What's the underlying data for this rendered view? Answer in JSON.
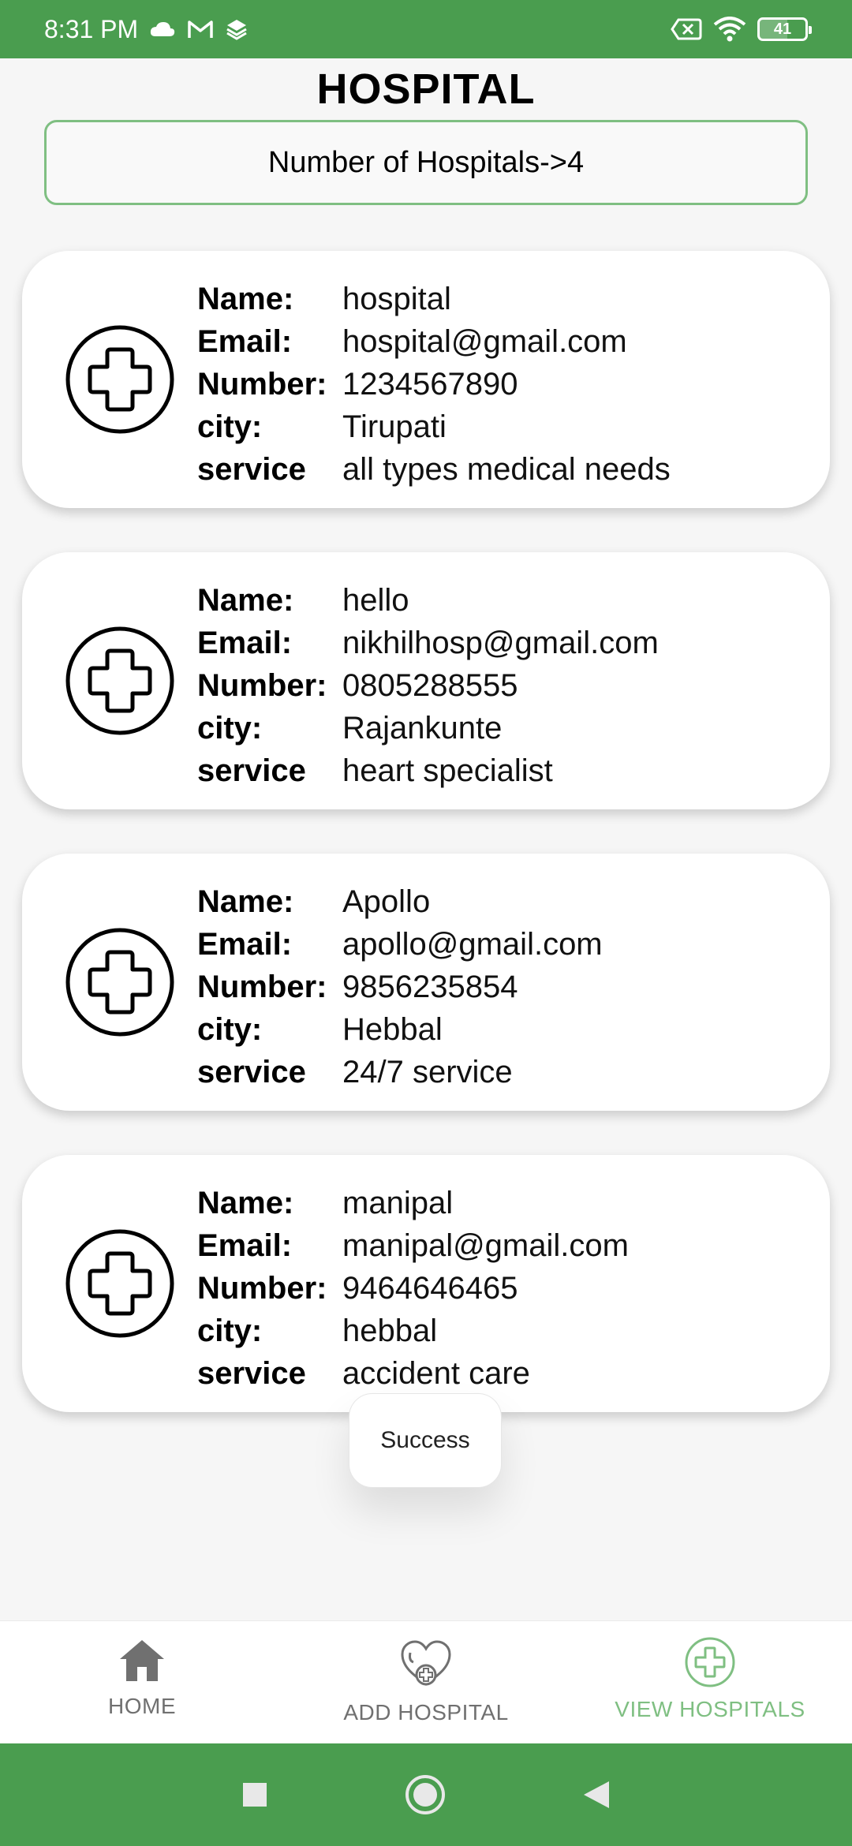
{
  "status_bar": {
    "time": "8:31 PM",
    "battery_level": "41",
    "icons": [
      "cloud-icon",
      "gmail-icon",
      "layers-icon",
      "sim-off-icon",
      "wifi-icon",
      "battery-icon"
    ]
  },
  "header": {
    "title": "HOSPITAL",
    "count_text": "Number of Hospitals->4"
  },
  "field_labels": {
    "name": "Name:",
    "email": "Email:",
    "number": "Number:",
    "city": "city:",
    "service": "service"
  },
  "hospitals": [
    {
      "name": "hospital",
      "email": "hospital@gmail.com",
      "number": "1234567890",
      "city": "Tirupati",
      "service": "all types medical needs"
    },
    {
      "name": "hello",
      "email": "nikhilhosp@gmail.com",
      "number": "0805288555",
      "city": "Rajankunte",
      "service": "heart specialist"
    },
    {
      "name": "Apollo",
      "email": "apollo@gmail.com",
      "number": "9856235854",
      "city": "Hebbal",
      "service": "24/7 service"
    },
    {
      "name": "manipal",
      "email": "manipal@gmail.com",
      "number": "9464646465",
      "city": "hebbal",
      "service": "accident care"
    }
  ],
  "toast": {
    "message": "Success"
  },
  "bottom_nav": {
    "items": [
      {
        "label": "HOME",
        "icon": "home-icon"
      },
      {
        "label": "ADD HOSPITAL",
        "icon": "heart-plus-icon"
      },
      {
        "label": "VIEW HOSPITALS",
        "icon": "circle-plus-icon",
        "active": true
      }
    ]
  },
  "colors": {
    "primary_green": "#4a9d4f",
    "accent_green": "#7fbf82",
    "inactive_gray": "#707070"
  }
}
